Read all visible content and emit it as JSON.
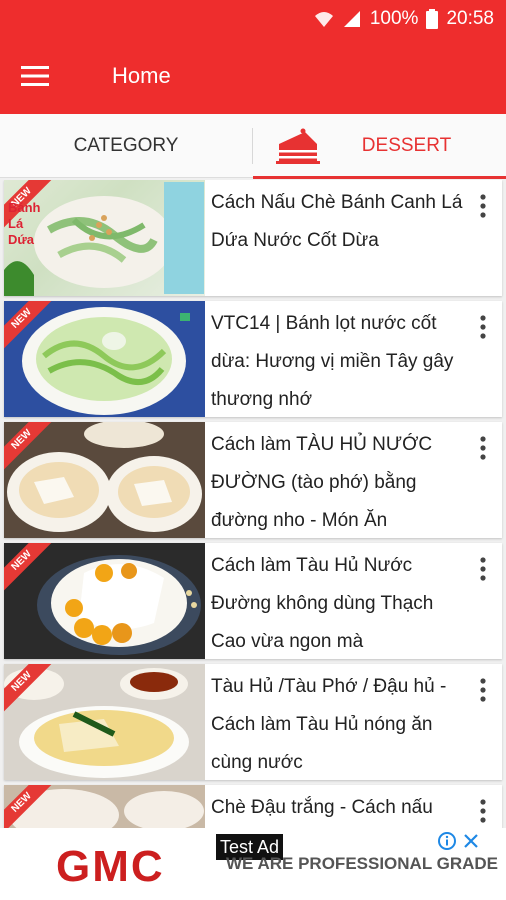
{
  "status_bar": {
    "battery": "100%",
    "time": "20:58"
  },
  "app_bar": {
    "title": "Home"
  },
  "tabs": [
    {
      "label": "CATEGORY"
    },
    {
      "label": "DESSERT"
    }
  ],
  "list": {
    "items": [
      {
        "title": "Cách Nấu Chè Bánh Canh Lá Dứa Nước Cốt Dừa",
        "thumb_text": "Bánh Lá Dứa",
        "badge": "NEW"
      },
      {
        "title": "VTC14 | Bánh lọt nước cốt dừa: Hương vị miền Tây gây thương nhớ",
        "badge": "NEW"
      },
      {
        "title": "Cách làm TÀU HỦ NƯỚC ĐƯỜNG (tào phớ) bằng đường nho - Món Ăn",
        "badge": "NEW"
      },
      {
        "title": "Cách làm Tàu Hủ Nước Đường không dùng Thạch Cao vừa ngon mà",
        "badge": "NEW"
      },
      {
        "title": "Tàu Hủ /Tàu Phớ / Đậu hủ - Cách làm Tàu Hủ nóng ăn cùng nước",
        "badge": "NEW"
      },
      {
        "title": "Chè Đậu trắng - Cách nấu",
        "badge": "NEW"
      }
    ]
  },
  "ad": {
    "label": "Test Ad",
    "logo": "GMC",
    "tagline": "WE ARE PROFESSIONAL GRADE"
  },
  "colors": {
    "primary": "#ee2d2d",
    "accent": "#e73232"
  }
}
